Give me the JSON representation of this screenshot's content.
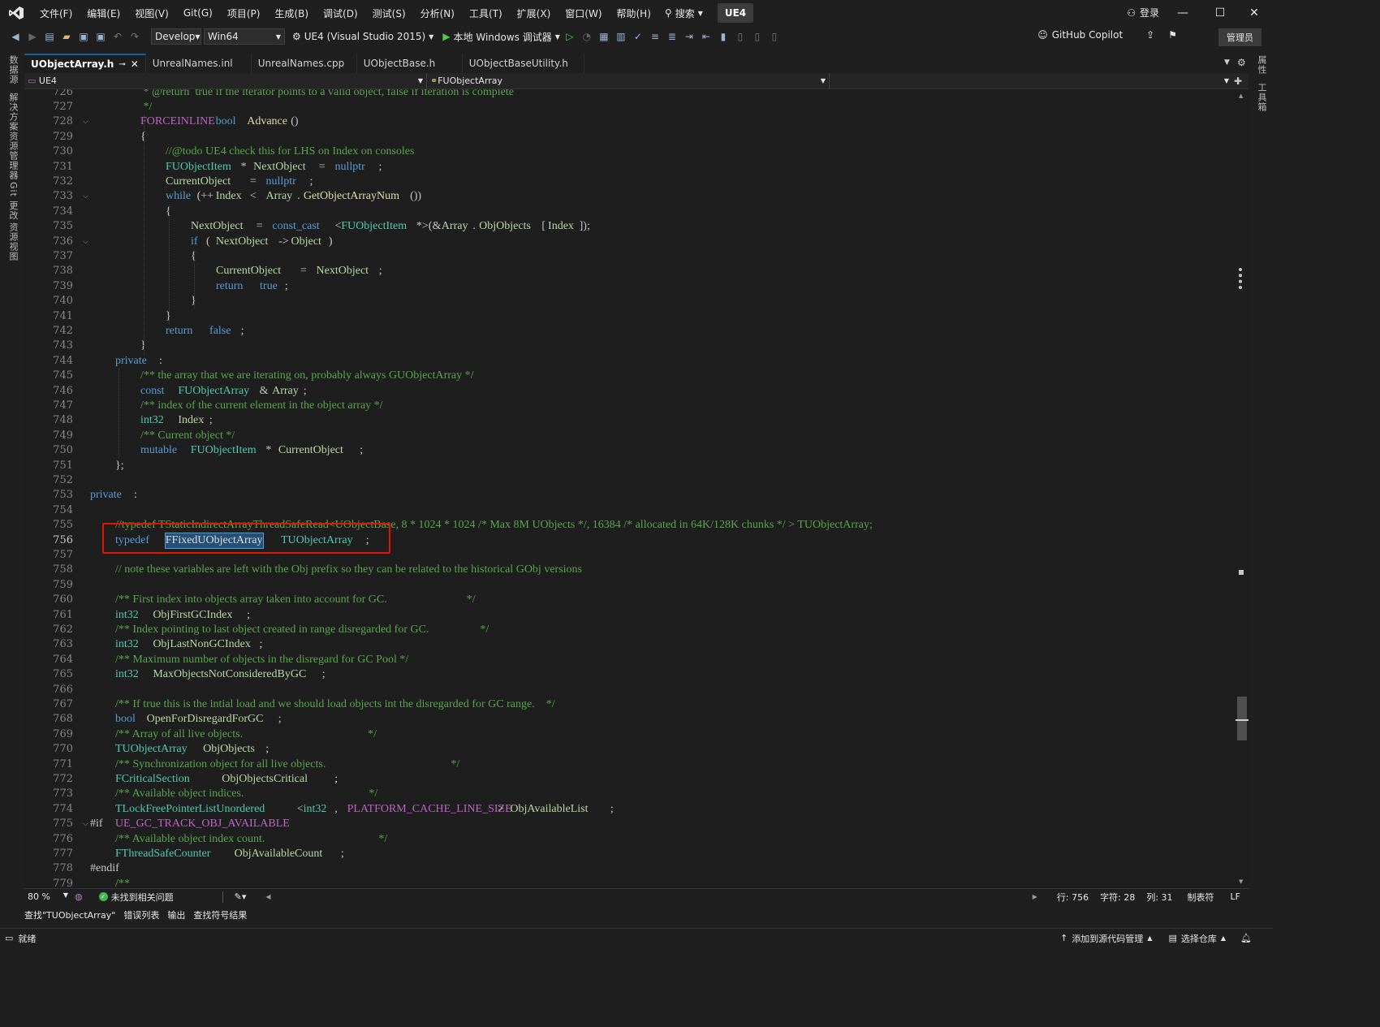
{
  "titlebar": {
    "menus": [
      "文件(F)",
      "编辑(E)",
      "视图(V)",
      "Git(G)",
      "项目(P)",
      "生成(B)",
      "调试(D)",
      "测试(S)",
      "分析(N)",
      "工具(T)",
      "扩展(X)",
      "窗口(W)",
      "帮助(H)"
    ],
    "search_label": "搜索",
    "solution_badge": "UE4",
    "login_label": "登录"
  },
  "toolbar": {
    "configuration": "Develop",
    "platform": "Win64",
    "startup_project": "UE4 (Visual Studio 2015)",
    "debugger": "本地 Windows 调试器",
    "copilot_label": "GitHub Copilot",
    "admin_label": "管理员"
  },
  "left_tool_tabs": [
    "数据源",
    "解决方案资源管理器",
    "Git 更改",
    "资源视图"
  ],
  "right_tool_tabs": [
    "属性",
    "工具箱"
  ],
  "tabs": [
    {
      "label": "UObjectArray.h",
      "active": true
    },
    {
      "label": "UnrealNames.inl",
      "active": false
    },
    {
      "label": "UnrealNames.cpp",
      "active": false
    },
    {
      "label": "UObjectBase.h",
      "active": false
    },
    {
      "label": "UObjectBaseUtility.h",
      "active": false
    }
  ],
  "navbar": {
    "project": "UE4",
    "scope": "FUObjectArray"
  },
  "editor": {
    "current_line": 756,
    "line_numbers": [
      726,
      727,
      728,
      729,
      730,
      731,
      732,
      733,
      734,
      735,
      736,
      737,
      738,
      739,
      740,
      741,
      742,
      743,
      744,
      745,
      746,
      747,
      748,
      749,
      750,
      751,
      752,
      753,
      754,
      755,
      756,
      757,
      758,
      759,
      760,
      761,
      762,
      763,
      764,
      765,
      766,
      767,
      768,
      769,
      770,
      771,
      772,
      773,
      774,
      775,
      776,
      777,
      778,
      779
    ],
    "lines": [
      [
        [
          "c",
          "\t\t * @return  true if the iterator points to a valid object, false if iteration is complete"
        ]
      ],
      [
        [
          "c",
          "\t\t */"
        ]
      ],
      [
        [
          "mac",
          "\t\tFORCEINLINE "
        ],
        [
          "k",
          "bool "
        ],
        [
          "f",
          "Advance"
        ],
        [
          "p",
          "()"
        ]
      ],
      [
        [
          "p",
          "\t\t{"
        ]
      ],
      [
        [
          "c",
          "\t\t\t//@todo UE4 check this for LHS on Index on consoles"
        ]
      ],
      [
        [
          "t",
          "\t\t\tFUObjectItem"
        ],
        [
          "p",
          "* "
        ],
        [
          "m",
          "NextObject"
        ],
        [
          "p",
          " = "
        ],
        [
          "k",
          "nullptr"
        ],
        [
          "p",
          ";"
        ]
      ],
      [
        [
          "m",
          "\t\t\tCurrentObject"
        ],
        [
          "p",
          " = "
        ],
        [
          "k",
          "nullptr"
        ],
        [
          "p",
          ";"
        ]
      ],
      [
        [
          "k",
          "\t\t\twhile"
        ],
        [
          "p",
          "(++"
        ],
        [
          "m",
          "Index"
        ],
        [
          "p",
          " < "
        ],
        [
          "m",
          "Array"
        ],
        [
          "p",
          "."
        ],
        [
          "f",
          "GetObjectArrayNum"
        ],
        [
          "p",
          "())"
        ]
      ],
      [
        [
          "p",
          "\t\t\t{"
        ]
      ],
      [
        [
          "m",
          "\t\t\t\tNextObject"
        ],
        [
          "p",
          " = "
        ],
        [
          "k",
          "const_cast"
        ],
        [
          "p",
          "<"
        ],
        [
          "t",
          "FUObjectItem"
        ],
        [
          "p",
          "*>(&"
        ],
        [
          "m",
          "Array"
        ],
        [
          "p",
          "."
        ],
        [
          "m",
          "ObjObjects"
        ],
        [
          "p",
          "["
        ],
        [
          "m",
          "Index"
        ],
        [
          "p",
          "]);"
        ]
      ],
      [
        [
          "k",
          "\t\t\t\tif"
        ],
        [
          "p",
          " ("
        ],
        [
          "m",
          "NextObject"
        ],
        [
          "p",
          "->"
        ],
        [
          "m",
          "Object"
        ],
        [
          "p",
          ")"
        ]
      ],
      [
        [
          "p",
          "\t\t\t\t{"
        ]
      ],
      [
        [
          "m",
          "\t\t\t\t\tCurrentObject"
        ],
        [
          "p",
          " = "
        ],
        [
          "m",
          "NextObject"
        ],
        [
          "p",
          ";"
        ]
      ],
      [
        [
          "k",
          "\t\t\t\t\treturn "
        ],
        [
          "k",
          "true"
        ],
        [
          "p",
          ";"
        ]
      ],
      [
        [
          "p",
          "\t\t\t\t}"
        ]
      ],
      [
        [
          "p",
          "\t\t\t}"
        ]
      ],
      [
        [
          "k",
          "\t\t\treturn "
        ],
        [
          "k",
          "false"
        ],
        [
          "p",
          ";"
        ]
      ],
      [
        [
          "p",
          "\t\t}"
        ]
      ],
      [
        [
          "k",
          "\tprivate"
        ],
        [
          "p",
          ":"
        ]
      ],
      [
        [
          "c",
          "\t\t/** the array that we are iterating on, probably always GUObjectArray */"
        ]
      ],
      [
        [
          "k",
          "\t\tconst "
        ],
        [
          "t",
          "FUObjectArray"
        ],
        [
          "p",
          "& "
        ],
        [
          "m",
          "Array"
        ],
        [
          "p",
          ";"
        ]
      ],
      [
        [
          "c",
          "\t\t/** index of the current element in the object array */"
        ]
      ],
      [
        [
          "t",
          "\t\tint32 "
        ],
        [
          "m",
          "Index"
        ],
        [
          "p",
          ";"
        ]
      ],
      [
        [
          "c",
          "\t\t/** Current object */"
        ]
      ],
      [
        [
          "k",
          "\t\tmutable "
        ],
        [
          "t",
          "FUObjectItem"
        ],
        [
          "p",
          "* "
        ],
        [
          "m",
          "CurrentObject"
        ],
        [
          "p",
          ";"
        ]
      ],
      [
        [
          "p",
          "\t};"
        ]
      ],
      [
        [
          "p",
          ""
        ]
      ],
      [
        [
          "k",
          "private"
        ],
        [
          "p",
          ":"
        ]
      ],
      [
        [
          "p",
          ""
        ]
      ],
      [
        [
          "c",
          "\t//typedef TStaticIndirectArrayThreadSafeRead<UObjectBase, 8 * 1024 * 1024 /* Max 8M UObjects */, 16384 /* allocated in 64K/128K chunks */ > TUObjectArray;"
        ]
      ],
      [
        [
          "k",
          "\ttypedef "
        ],
        [
          "sel",
          "FFixedUObjectArray"
        ],
        [
          "t",
          " TUObjectArray"
        ],
        [
          "p",
          ";"
        ]
      ],
      [
        [
          "p",
          ""
        ]
      ],
      [
        [
          "c",
          "\t// note these variables are left with the Obj prefix so they can be related to the historical GObj versions"
        ]
      ],
      [
        [
          "p",
          ""
        ]
      ],
      [
        [
          "c",
          "\t/** First index into objects array taken into account for GC.                            */"
        ]
      ],
      [
        [
          "t",
          "\tint32 "
        ],
        [
          "m",
          "ObjFirstGCIndex"
        ],
        [
          "p",
          ";"
        ]
      ],
      [
        [
          "c",
          "\t/** Index pointing to last object created in range disregarded for GC.                  */"
        ]
      ],
      [
        [
          "t",
          "\tint32 "
        ],
        [
          "m",
          "ObjLastNonGCIndex"
        ],
        [
          "p",
          ";"
        ]
      ],
      [
        [
          "c",
          "\t/** Maximum number of objects in the disregard for GC Pool */"
        ]
      ],
      [
        [
          "t",
          "\tint32 "
        ],
        [
          "m",
          "MaxObjectsNotConsideredByGC"
        ],
        [
          "p",
          ";"
        ]
      ],
      [
        [
          "p",
          ""
        ]
      ],
      [
        [
          "c",
          "\t/** If true this is the intial load and we should load objects int the disregarded for GC range.    */"
        ]
      ],
      [
        [
          "k",
          "\tbool "
        ],
        [
          "m",
          "OpenForDisregardForGC"
        ],
        [
          "p",
          ";"
        ]
      ],
      [
        [
          "c",
          "\t/** Array of all live objects.                                            */"
        ]
      ],
      [
        [
          "t",
          "\tTUObjectArray "
        ],
        [
          "m",
          "ObjObjects"
        ],
        [
          "p",
          ";"
        ]
      ],
      [
        [
          "c",
          "\t/** Synchronization object for all live objects.                                            */"
        ]
      ],
      [
        [
          "t",
          "\tFCriticalSection "
        ],
        [
          "m",
          "ObjObjectsCritical"
        ],
        [
          "p",
          ";"
        ]
      ],
      [
        [
          "c",
          "\t/** Available object indices.                                            */"
        ]
      ],
      [
        [
          "t",
          "\tTLockFreePointerListUnordered"
        ],
        [
          "p",
          "<"
        ],
        [
          "t",
          "int32"
        ],
        [
          "p",
          ", "
        ],
        [
          "mac",
          "PLATFORM_CACHE_LINE_SIZE"
        ],
        [
          "p",
          "> "
        ],
        [
          "m",
          "ObjAvailableList"
        ],
        [
          "p",
          ";"
        ]
      ],
      [
        [
          "p",
          "#if "
        ],
        [
          "mac",
          "UE_GC_TRACK_OBJ_AVAILABLE"
        ]
      ],
      [
        [
          "c",
          "\t/** Available object index count.                                        */"
        ]
      ],
      [
        [
          "t",
          "\tFThreadSafeCounter "
        ],
        [
          "m",
          "ObjAvailableCount"
        ],
        [
          "p",
          ";"
        ]
      ],
      [
        [
          "p",
          "#endif"
        ]
      ],
      [
        [
          "c",
          "\t/**"
        ]
      ]
    ]
  },
  "status_row": {
    "zoom": "80 %",
    "issues": "未找到相关问题",
    "line": "行: 756",
    "char": "字符: 28",
    "col": "列: 31",
    "tabs": "制表符",
    "eol": "LF"
  },
  "bottom_tabs": [
    "查找\"TUObjectArray\"",
    "错误列表",
    "输出",
    "查找符号结果"
  ],
  "statusbar": {
    "ready": "就绪",
    "source_control": "添加到源代码管理",
    "repo": "选择仓库"
  },
  "colors": {
    "accent": "#0e639c",
    "highlight_box": "#e51400",
    "selection": "#264f78",
    "comment": "#57a64a",
    "keyword": "#569cd6",
    "type": "#4ec9b0"
  }
}
